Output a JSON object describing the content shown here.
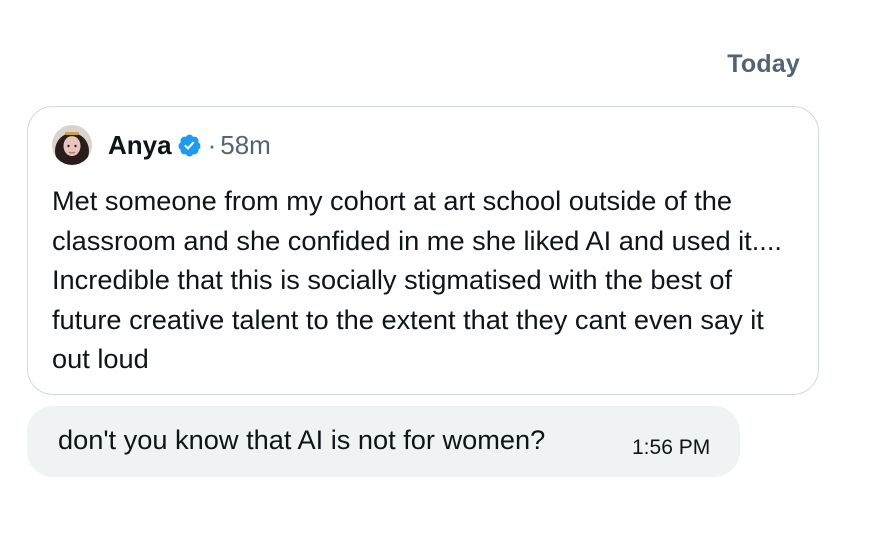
{
  "conversation": {
    "date_divider": "Today"
  },
  "quoted_post": {
    "author_name": "Anya",
    "verified": true,
    "separator": "·",
    "time_ago": "58m",
    "text": "Met someone from my cohort at art school outside of the classroom and she confided in me she liked AI and used it.... Incredible that this is socially stigmatised with the best of future creative talent to the extent that they cant even say it out loud",
    "avatar_icon": "avatar-photo",
    "verified_color": "#1d9bf0"
  },
  "message": {
    "text": "don't you know that AI is not for women?",
    "time": "1:56 PM",
    "bubble_color": "#eff3f4"
  }
}
